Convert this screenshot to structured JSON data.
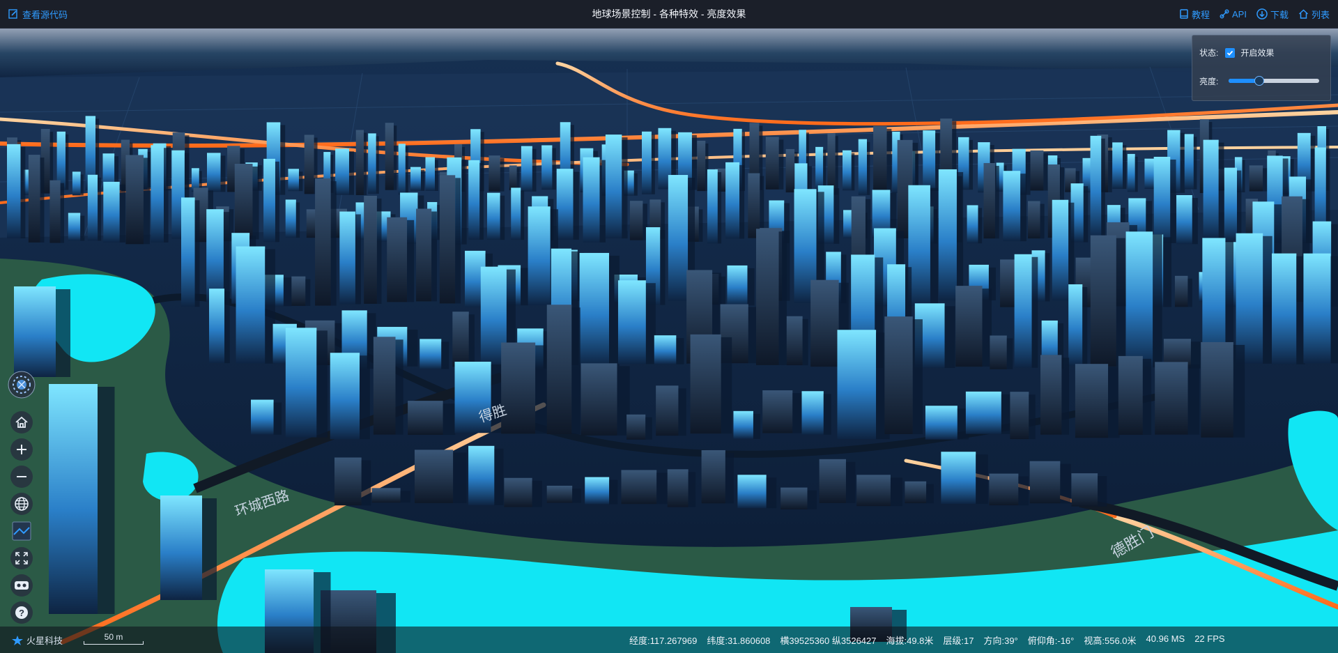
{
  "header": {
    "view_source_label": "查看源代码",
    "title": "地球场景控制 - 各种特效 - 亮度效果",
    "nav": [
      {
        "label": "教程",
        "icon": "book-icon"
      },
      {
        "label": "API",
        "icon": "api-link-icon"
      },
      {
        "label": "下载",
        "icon": "download-icon"
      },
      {
        "label": "列表",
        "icon": "home-icon"
      }
    ]
  },
  "panel": {
    "state_label": "状态:",
    "enable_label": "开启效果",
    "enabled": true,
    "brightness_label": "亮度:",
    "brightness_value": 0.33
  },
  "toolbar": [
    {
      "name": "compass-icon"
    },
    {
      "name": "home-view-icon"
    },
    {
      "name": "zoom-in-icon"
    },
    {
      "name": "zoom-out-icon"
    },
    {
      "name": "globe-icon"
    },
    {
      "name": "basemap-icon"
    },
    {
      "name": "fullscreen-icon"
    },
    {
      "name": "vr-icon"
    },
    {
      "name": "help-icon"
    }
  ],
  "bottom": {
    "logo_text": "火星科技",
    "scale_label": "50 m",
    "longitude": "经度:117.267969",
    "latitude": "纬度:31.860608",
    "projected": "横39525360 纵3526427",
    "altitude": "海拔:49.8米",
    "level": "层级:17",
    "heading": "方向:39°",
    "pitch": "俯仰角:-16°",
    "view_height": "视高:556.0米",
    "frame_time": "40.96 MS",
    "fps": "22 FPS"
  },
  "map_labels": {
    "road_1": "环城西路",
    "road_2": "德胜门",
    "road_3": "得胜"
  },
  "colors": {
    "accent": "#2f9bff",
    "water": "#11e6f4",
    "building_top": "#6fe0ff",
    "road_glow": "#ff8a3a",
    "green": "#2b5a46"
  }
}
